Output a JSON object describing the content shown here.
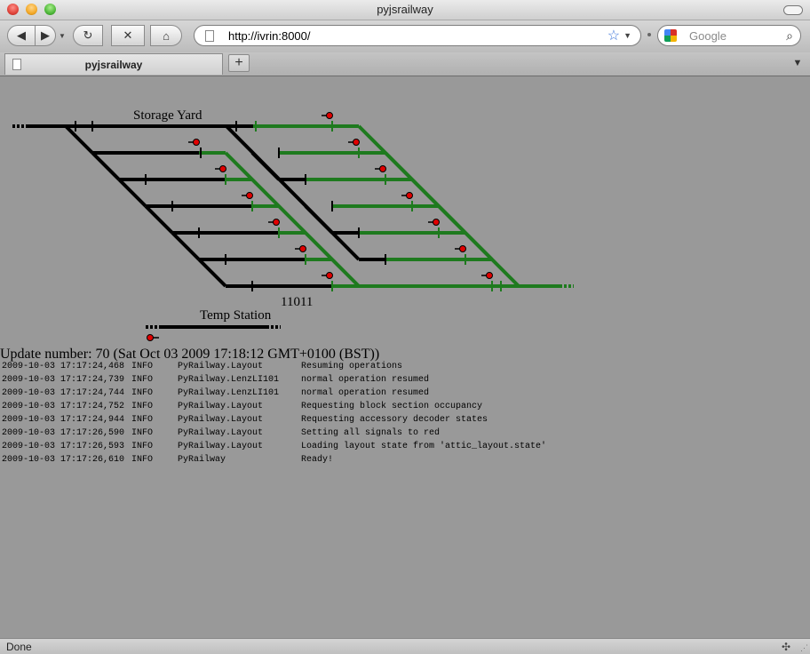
{
  "window": {
    "title": "pyjsrailway"
  },
  "toolbar": {
    "url": "http://ivrin:8000/",
    "search_placeholder": "Google",
    "icons": {
      "back": "back-arrow-icon",
      "forward": "forward-arrow-icon",
      "reload": "reload-icon",
      "stop": "stop-icon",
      "home": "home-icon",
      "bookmark": "star-icon",
      "search": "magnifier-icon"
    }
  },
  "tabs": [
    {
      "label": "pyjsrailway"
    }
  ],
  "layout": {
    "storage_yard_label": "Storage Yard",
    "temp_station_label": "Temp Station",
    "loco_label": "11011",
    "colors": {
      "occupied": "#1e7a1e",
      "free": "#000000",
      "signal": "#e00000"
    }
  },
  "update": {
    "text": "Update number: 70 (Sat Oct 03 2009 17:18:12 GMT+0100 (BST))"
  },
  "log": [
    {
      "time": "2009-10-03 17:17:24,468",
      "level": "INFO",
      "source": "PyRailway.Layout",
      "message": "Resuming operations"
    },
    {
      "time": "2009-10-03 17:17:24,739",
      "level": "INFO",
      "source": "PyRailway.LenzLI101",
      "message": "normal operation resumed"
    },
    {
      "time": "2009-10-03 17:17:24,744",
      "level": "INFO",
      "source": "PyRailway.LenzLI101",
      "message": "normal operation resumed"
    },
    {
      "time": "2009-10-03 17:17:24,752",
      "level": "INFO",
      "source": "PyRailway.Layout",
      "message": "Requesting block section occupancy"
    },
    {
      "time": "2009-10-03 17:17:24,944",
      "level": "INFO",
      "source": "PyRailway.Layout",
      "message": "Requesting accessory decoder states"
    },
    {
      "time": "2009-10-03 17:17:26,590",
      "level": "INFO",
      "source": "PyRailway.Layout",
      "message": "Setting all signals to red"
    },
    {
      "time": "2009-10-03 17:17:26,593",
      "level": "INFO",
      "source": "PyRailway.Layout",
      "message": "Loading layout state from 'attic_layout.state'"
    },
    {
      "time": "2009-10-03 17:17:26,610",
      "level": "INFO",
      "source": "PyRailway",
      "message": "Ready!"
    }
  ],
  "status": {
    "text": "Done"
  }
}
